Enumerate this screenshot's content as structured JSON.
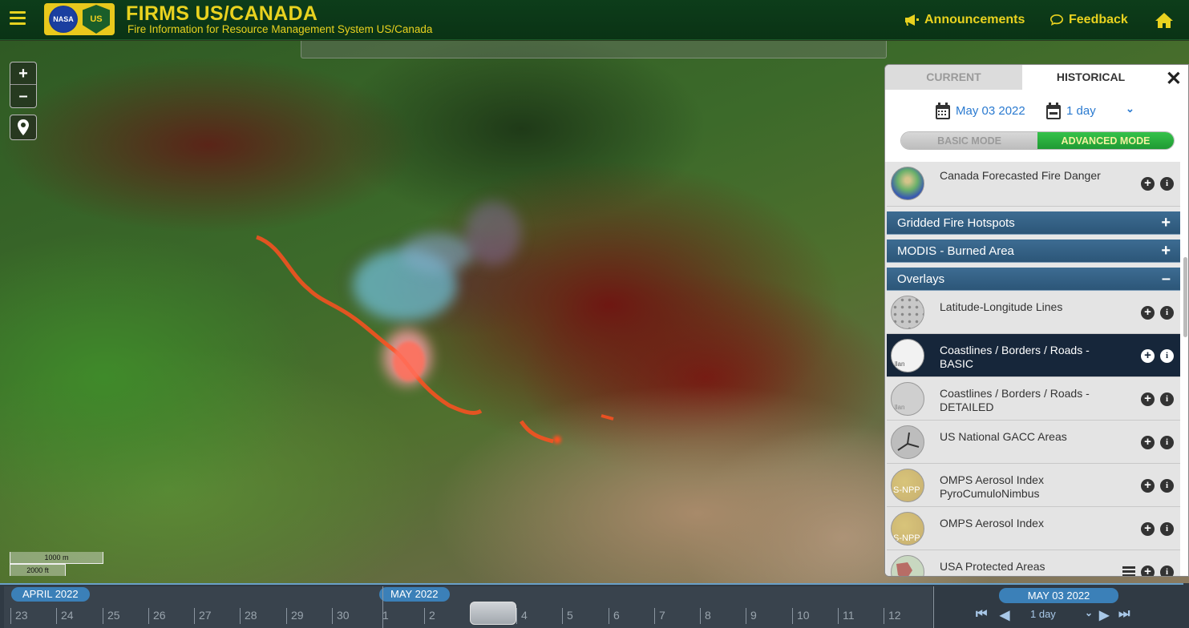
{
  "header": {
    "title": "FIRMS US/CANADA",
    "subtitle": "Fire Information for Resource Management System US/Canada",
    "logo_nasa": "NASA",
    "logo_usfs": "US",
    "announcements": "Announcements",
    "feedback": "Feedback",
    "icons": [
      "menu-icon",
      "megaphone-icon",
      "chat-icon",
      "home-icon"
    ]
  },
  "map": {
    "zoom_in": "+",
    "zoom_out": "–",
    "scale_metric": "1000 m",
    "scale_imperial": "2000 ft"
  },
  "panel": {
    "tabs": [
      "CURRENT",
      "HISTORICAL"
    ],
    "active_tab": "HISTORICAL",
    "date": "May 03 2022",
    "range": "1 day",
    "modes": [
      "BASIC MODE",
      "ADVANCED MODE"
    ],
    "active_mode": "ADVANCED MODE",
    "layers_top": [
      {
        "name": "Canada Forecasted Fire Danger"
      }
    ],
    "groups": [
      {
        "name": "Gridded Fire Hotspots",
        "state": "+"
      },
      {
        "name": "MODIS - Burned Area",
        "state": "+"
      },
      {
        "name": "Overlays",
        "state": "–"
      }
    ],
    "overlays": [
      {
        "name": "Latitude-Longitude Lines",
        "thumb_label": ""
      },
      {
        "name": "Coastlines / Borders / Roads - BASIC",
        "thumb_label": "llan"
      },
      {
        "name": "Coastlines / Borders / Roads - DETAILED",
        "thumb_label": "llan"
      },
      {
        "name": "US National GACC Areas",
        "thumb_label": ""
      },
      {
        "name": "OMPS Aerosol Index PyroCumuloNimbus",
        "thumb_label": "S-NPP"
      },
      {
        "name": "OMPS Aerosol Index",
        "thumb_label": "S-NPP"
      },
      {
        "name": "USA Protected Areas",
        "thumb_label": ""
      }
    ],
    "add_symbol": "+",
    "info_symbol": "i",
    "close_symbol": "✕"
  },
  "timeline": {
    "months": [
      "APRIL 2022",
      "MAY 2022"
    ],
    "april_days": [
      "23",
      "24",
      "25",
      "26",
      "27",
      "28",
      "29",
      "30"
    ],
    "may_days": [
      "1",
      "2",
      "4",
      "5",
      "6",
      "7",
      "8",
      "9",
      "10",
      "11",
      "12"
    ],
    "current_date": "MAY 03 2022",
    "range": "1 day"
  }
}
